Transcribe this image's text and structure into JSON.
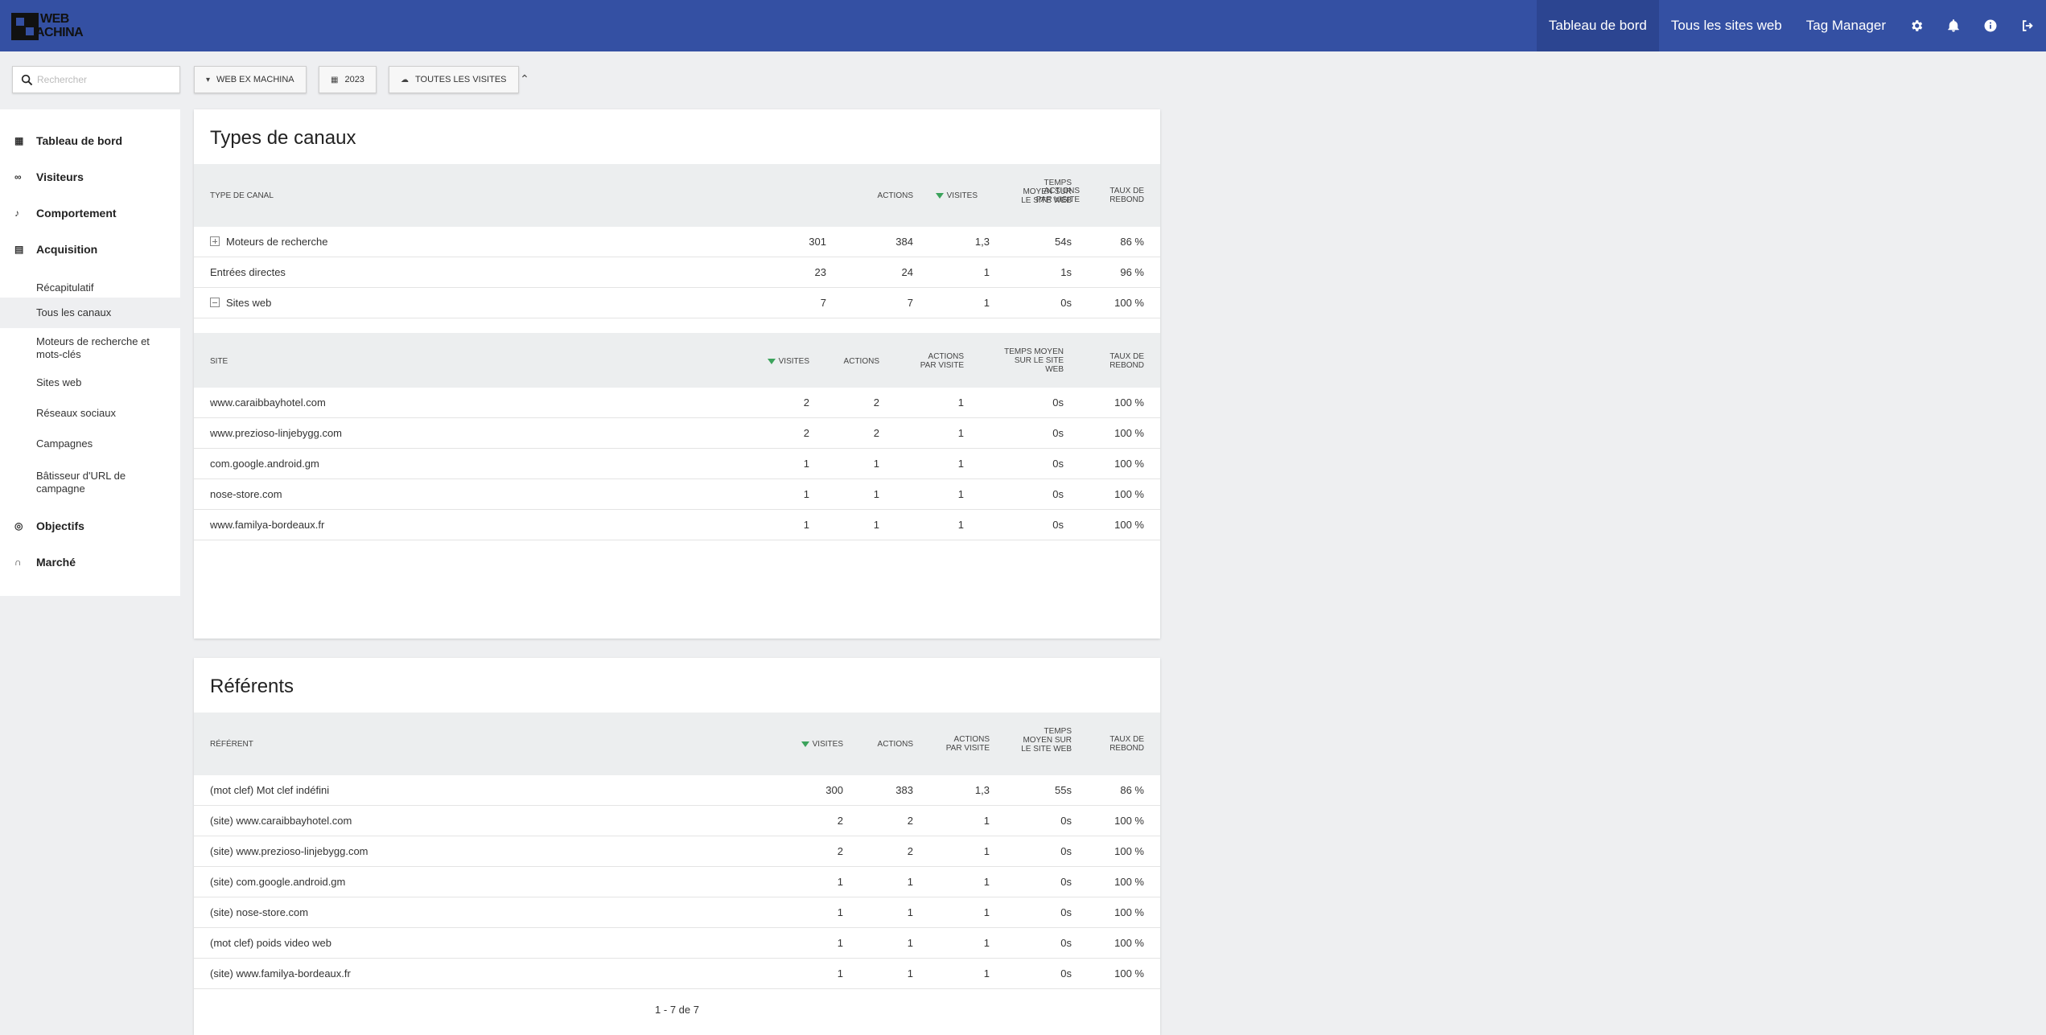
{
  "header": {
    "logo_line1": "WEB",
    "logo_line2": "ACHINA",
    "nav": [
      "Tableau de bord",
      "Tous les sites web",
      "Tag Manager"
    ],
    "icons": [
      "gear-icon",
      "bell-icon",
      "info-icon",
      "logout-icon"
    ]
  },
  "toolbar": {
    "search_placeholder": "Rechercher",
    "site_selector": "WEB EX MACHINA",
    "period_selector": "2023",
    "segment_selector": "TOUTES LES VISITES"
  },
  "sidebar": {
    "categories": [
      {
        "label": "Tableau de bord",
        "icon": "dashboard-grid-icon"
      },
      {
        "label": "Visiteurs",
        "icon": "binoculars-icon"
      },
      {
        "label": "Comportement",
        "icon": "bell-icon"
      },
      {
        "label": "Acquisition",
        "icon": "calendar-icon"
      },
      {
        "label": "Objectifs",
        "icon": "target-icon"
      },
      {
        "label": "Marché",
        "icon": "headset-icon"
      }
    ],
    "acquisition_items": [
      "Récapitulatif",
      "Tous les canaux",
      "Moteurs de recherche et mots-clés",
      "Sites web",
      "Réseaux sociaux",
      "Campagnes",
      "Bâtisseur d'URL de campagne"
    ],
    "active_item": "Tous les canaux"
  },
  "channels": {
    "title": "Types de canaux",
    "headers": {
      "label": "TYPE DE CANAL",
      "visits": "VISITES",
      "actions": "ACTIONS",
      "apv": "ACTIONS PAR VISITE",
      "time": "TEMPS MOYEN SUR LE SITE WEB",
      "bounce": "TAUX DE REBOND"
    },
    "rows": [
      {
        "label": "Moteurs de recherche",
        "visits": "301",
        "actions": "384",
        "apv": "1,3",
        "time": "54s",
        "bounce": "86 %"
      },
      {
        "label": "Entrées directes",
        "visits": "23",
        "actions": "24",
        "apv": "1",
        "time": "1s",
        "bounce": "96 %"
      },
      {
        "label": "Sites web",
        "visits": "7",
        "actions": "7",
        "apv": "1",
        "time": "0s",
        "bounce": "100 %"
      }
    ],
    "subtable": {
      "headers": {
        "label": "SITE",
        "visits": "VISITES",
        "actions": "ACTIONS",
        "apv": "ACTIONS PAR VISITE",
        "time": "TEMPS MOYEN SUR LE SITE WEB",
        "bounce": "TAUX DE REBOND"
      },
      "rows": [
        {
          "label": "www.caraibbayhotel.com",
          "visits": "2",
          "actions": "2",
          "apv": "1",
          "time": "0s",
          "bounce": "100 %"
        },
        {
          "label": "www.prezioso-linjebygg.com",
          "visits": "2",
          "actions": "2",
          "apv": "1",
          "time": "0s",
          "bounce": "100 %"
        },
        {
          "label": "com.google.android.gm",
          "visits": "1",
          "actions": "1",
          "apv": "1",
          "time": "0s",
          "bounce": "100 %"
        },
        {
          "label": "nose-store.com",
          "visits": "1",
          "actions": "1",
          "apv": "1",
          "time": "0s",
          "bounce": "100 %"
        },
        {
          "label": "www.familya-bordeaux.fr",
          "visits": "1",
          "actions": "1",
          "apv": "1",
          "time": "0s",
          "bounce": "100 %"
        }
      ]
    }
  },
  "referrers": {
    "title": "Référents",
    "headers": {
      "label": "RÉFÉRENT",
      "visits": "VISITES",
      "actions": "ACTIONS",
      "apv": "ACTIONS PAR VISITE",
      "time": "TEMPS MOYEN SUR LE SITE WEB",
      "bounce": "TAUX DE REBOND"
    },
    "rows": [
      {
        "label": "(mot clef) Mot clef indéfini",
        "visits": "300",
        "actions": "383",
        "apv": "1,3",
        "time": "55s",
        "bounce": "86 %"
      },
      {
        "label": "(site) www.caraibbayhotel.com",
        "visits": "2",
        "actions": "2",
        "apv": "1",
        "time": "0s",
        "bounce": "100 %"
      },
      {
        "label": "(site) www.prezioso-linjebygg.com",
        "visits": "2",
        "actions": "2",
        "apv": "1",
        "time": "0s",
        "bounce": "100 %"
      },
      {
        "label": "(site) com.google.android.gm",
        "visits": "1",
        "actions": "1",
        "apv": "1",
        "time": "0s",
        "bounce": "100 %"
      },
      {
        "label": "(site) nose-store.com",
        "visits": "1",
        "actions": "1",
        "apv": "1",
        "time": "0s",
        "bounce": "100 %"
      },
      {
        "label": "(mot clef) poids video web",
        "visits": "1",
        "actions": "1",
        "apv": "1",
        "time": "0s",
        "bounce": "100 %"
      },
      {
        "label": "(site) www.familya-bordeaux.fr",
        "visits": "1",
        "actions": "1",
        "apv": "1",
        "time": "0s",
        "bounce": "100 %"
      }
    ],
    "pagination": "1 - 7 de 7"
  }
}
